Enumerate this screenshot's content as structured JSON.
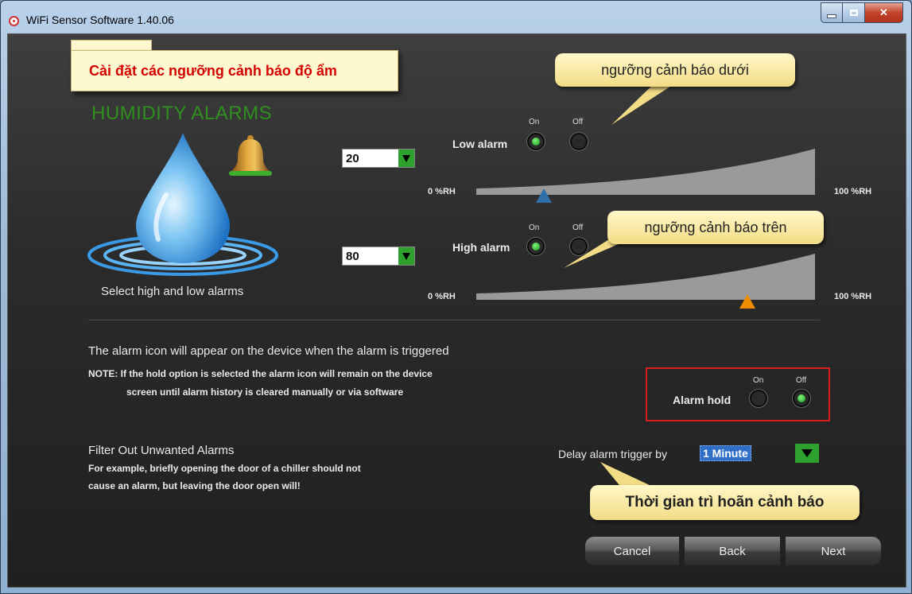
{
  "window": {
    "title": "WiFi Sensor Software 1.40.06"
  },
  "annotations": {
    "top_note": "Cài đặt các ngưỡng cảnh báo độ ẩm",
    "low_threshold": "ngưỡng cảnh báo dưới",
    "high_threshold": "ngưỡng cảnh báo trên",
    "delay_note": "Thời gian trì hoãn cảnh báo"
  },
  "section": {
    "title": "HUMIDITY ALARMS",
    "caption": "Select high and low alarms"
  },
  "low_alarm": {
    "label": "Low alarm",
    "on_label": "On",
    "off_label": "Off",
    "selected": "On",
    "value": "20",
    "scale_min": "0 %RH",
    "scale_max": "100 %RH",
    "marker_percent": 20,
    "marker_color": "#2f6fa8"
  },
  "high_alarm": {
    "label": "High alarm",
    "on_label": "On",
    "off_label": "Off",
    "selected": "On",
    "value": "80",
    "scale_min": "0 %RH",
    "scale_max": "100 %RH",
    "marker_percent": 80,
    "marker_color": "#f08c00"
  },
  "info": {
    "line1": "The alarm icon will appear on the device when the alarm is triggered",
    "note_line1": "NOTE: If the hold option is selected the alarm icon will remain on the device",
    "note_line2": "screen until alarm history is cleared manually or via software"
  },
  "alarm_hold": {
    "label": "Alarm hold",
    "on_label": "On",
    "off_label": "Off",
    "selected": "Off"
  },
  "filter": {
    "title": "Filter Out Unwanted Alarms",
    "line1": "For example, briefly opening the door of a chiller should not",
    "line2": "cause an alarm, but leaving the door open will!"
  },
  "delay": {
    "label": "Delay alarm trigger by",
    "value": "1 Minute"
  },
  "buttons": {
    "cancel": "Cancel",
    "back": "Back",
    "next": "Next"
  },
  "colors": {
    "accent_green": "#2f8f1f",
    "highlight_red": "#d81e1e"
  }
}
